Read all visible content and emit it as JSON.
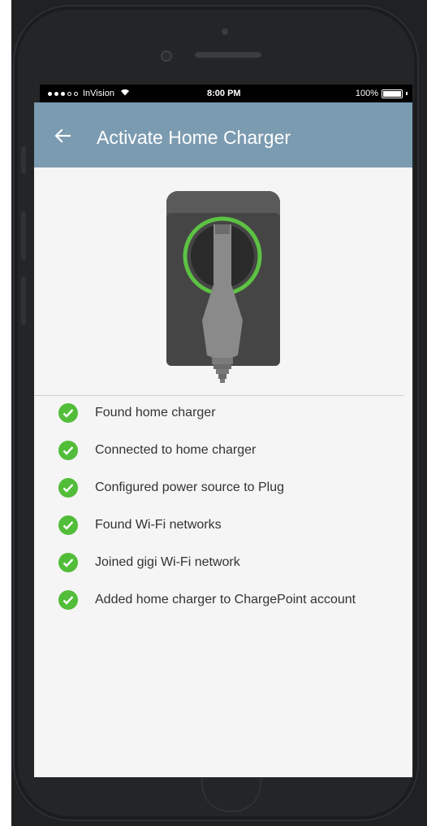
{
  "status_bar": {
    "carrier": "InVision",
    "time": "8:00 PM",
    "battery_text": "100%",
    "battery_level": 1.0,
    "signal_bars_filled": 3,
    "signal_bars_total": 5
  },
  "app_bar": {
    "title": "Activate Home Charger",
    "back_icon": "arrow-left-icon"
  },
  "illustration": {
    "icon": "home-charger-icon",
    "ring_color": "#5dc143"
  },
  "steps": [
    {
      "label": "Found home charger",
      "status": "complete"
    },
    {
      "label": "Connected to home charger",
      "status": "complete"
    },
    {
      "label": "Configured power source to Plug",
      "status": "complete"
    },
    {
      "label": "Found Wi-Fi networks",
      "status": "complete"
    },
    {
      "label": "Joined gigi Wi-Fi network",
      "status": "complete"
    },
    {
      "label": "Added home charger to ChargePoint account",
      "status": "complete"
    }
  ],
  "colors": {
    "app_bar": "#7b9bb1",
    "check": "#52bd39",
    "background": "#f5f5f5"
  }
}
